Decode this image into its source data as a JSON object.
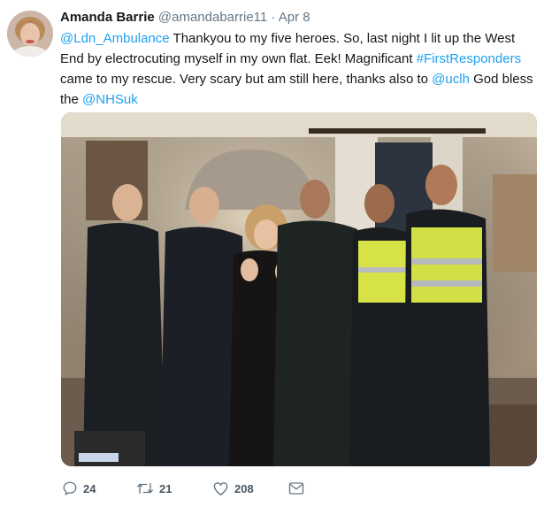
{
  "tweet": {
    "author_name": "Amanda Barrie",
    "handle": "@amandabarrie11",
    "separator": "·",
    "date": "Apr 8",
    "text": {
      "mention1": "@Ldn_Ambulance",
      "part1": " Thankyou to my five heroes. So, last night I lit up the West End by electrocuting myself in my own flat. Eek! Magnificant ",
      "hashtag": "#FirstResponders",
      "part2": " came to my rescue. Very scary but am still here, thanks also to ",
      "mention2": "@uclh",
      "part3": "  God bless the ",
      "mention3": "@NHSuk"
    },
    "actions": {
      "replies": "24",
      "retweets": "21",
      "likes": "208"
    }
  },
  "icons": {
    "reply": "reply-icon",
    "retweet": "retweet-icon",
    "like": "heart-icon",
    "message": "direct-message-icon"
  },
  "colors": {
    "link": "#1da1f2",
    "secondary_text": "#657786"
  }
}
